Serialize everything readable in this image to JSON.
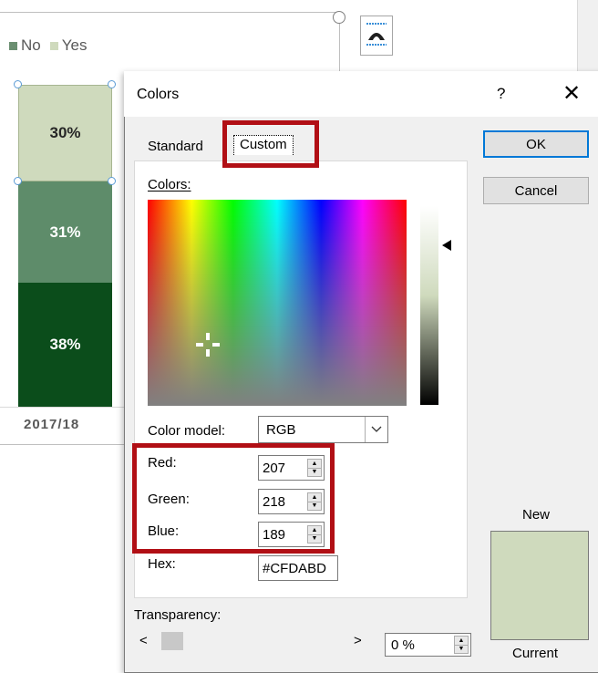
{
  "chart": {
    "legend": [
      {
        "label": "No",
        "color": "#6b8f71"
      },
      {
        "label": "Yes",
        "color": "#cfdabd"
      }
    ],
    "segments": [
      {
        "label": "30%",
        "color": "#cfdabd",
        "text_color": "#262626"
      },
      {
        "label": "31%",
        "color": "#5e8c6a",
        "text_color": "#ffffff"
      },
      {
        "label": "38%",
        "color": "#0b4d1b",
        "text_color": "#ffffff"
      }
    ],
    "axis_label": "2017/18"
  },
  "dialog": {
    "title": "Colors",
    "help_label": "?",
    "close_label": "✕",
    "tabs": [
      {
        "label": "Standard",
        "selected": false
      },
      {
        "label": "Custom",
        "selected": true
      }
    ],
    "ok_label": "OK",
    "cancel_label": "Cancel",
    "colors_label": "Colors:",
    "color_model_label": "Color model:",
    "color_model_value": "RGB",
    "red_label": "Red:",
    "red_value": "207",
    "green_label": "Green:",
    "green_value": "218",
    "blue_label": "Blue:",
    "blue_value": "189",
    "hex_label": "Hex:",
    "hex_value": "#CFDABD",
    "transparency_label": "Transparency:",
    "transparency_value": "0 %",
    "new_label": "New",
    "current_label": "Current",
    "new_color": "#cfdabd",
    "current_color": "#cfdabd",
    "highlight_color": "#b10f15",
    "accent_color": "#0078d7"
  }
}
